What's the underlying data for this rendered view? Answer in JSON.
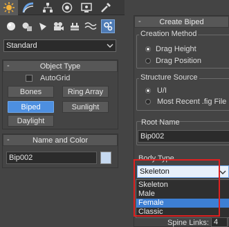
{
  "tabs": [
    {
      "icon": "create-icon",
      "active": true
    },
    {
      "icon": "modify-icon",
      "active": false
    },
    {
      "icon": "hierarchy-icon",
      "active": false
    },
    {
      "icon": "motion-icon",
      "active": false
    },
    {
      "icon": "display-icon",
      "active": false
    },
    {
      "icon": "utilities-icon",
      "active": false
    }
  ],
  "categories": [
    {
      "icon": "geometry-icon"
    },
    {
      "icon": "shapes-icon"
    },
    {
      "icon": "lights-icon"
    },
    {
      "icon": "cameras-icon"
    },
    {
      "icon": "helpers-icon"
    },
    {
      "icon": "spacewarps-icon"
    },
    {
      "icon": "systems-icon",
      "active": true
    }
  ],
  "subcategory": {
    "value": "Standard"
  },
  "object_type": {
    "marker": "-",
    "title": "Object Type",
    "autogrid_label": "AutoGrid",
    "autogrid_checked": false,
    "buttons": [
      "Bones",
      "Ring Array",
      "Biped",
      "Sunlight",
      "Daylight"
    ],
    "selected": "Biped"
  },
  "name_color": {
    "marker": "-",
    "title": "Name and Color",
    "name": "Bip002",
    "color": "#c6d9f0"
  },
  "create_biped": {
    "marker": "-",
    "title": "Create Biped",
    "creation_method": {
      "title": "Creation Method",
      "options": [
        "Drag Height",
        "Drag Position"
      ],
      "selected": 0
    },
    "structure_source": {
      "title": "Structure Source",
      "options": [
        "U/I",
        "Most Recent .fig File"
      ],
      "selected": 0
    },
    "root_name": {
      "title": "Root Name",
      "value": "Bip002"
    },
    "body_type": {
      "title": "Body Type",
      "value": "Skeleton",
      "options": [
        "Skeleton",
        "Male",
        "Female",
        "Classic"
      ],
      "highlighted": "Female"
    },
    "spine_links": {
      "label": "Spine Links:",
      "value": "4"
    }
  },
  "colors": {
    "accent": "#4d8fe0",
    "highlight_box": "#e02020",
    "panel_bg": "#444444"
  }
}
